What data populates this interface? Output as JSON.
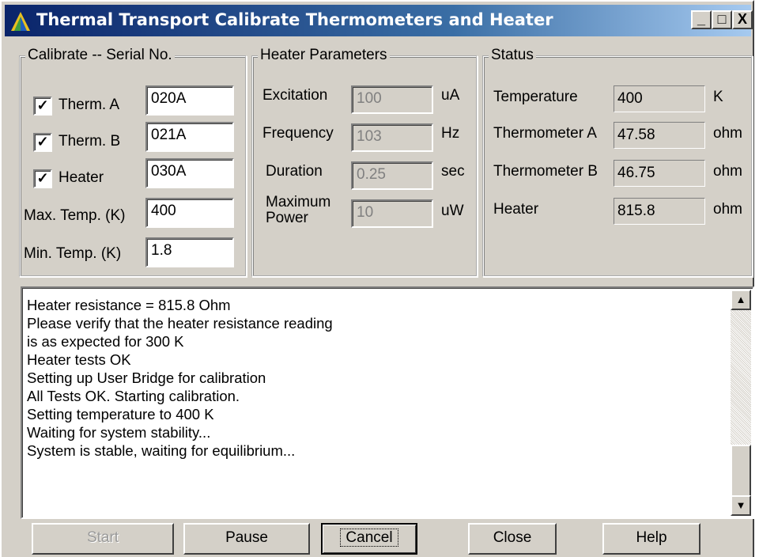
{
  "window": {
    "title": "Thermal Transport Calibrate Thermometers and Heater"
  },
  "caption_buttons": {
    "minimize": "_",
    "maximize": "□",
    "close": "X"
  },
  "calibrate": {
    "group_title": "Calibrate -- Serial No.",
    "items": [
      {
        "label": "Therm. A",
        "checked": true,
        "value": "020A"
      },
      {
        "label": "Therm. B",
        "checked": true,
        "value": "021A"
      },
      {
        "label": "Heater",
        "checked": true,
        "value": "030A"
      }
    ],
    "max_temp": {
      "label": "Max. Temp. (K)",
      "value": "400"
    },
    "min_temp": {
      "label": "Min. Temp. (K)",
      "value": "1.8"
    },
    "check_mark": "✓"
  },
  "heater_params": {
    "group_title": "Heater Parameters",
    "rows": [
      {
        "label": "Excitation",
        "value": "100",
        "unit": "uA"
      },
      {
        "label": "Frequency",
        "value": "103",
        "unit": "Hz"
      },
      {
        "label": "Duration",
        "value": "0.25",
        "unit": "sec"
      },
      {
        "label_line1": "Maximum",
        "label_line2": "Power",
        "value": "10",
        "unit": "uW"
      }
    ]
  },
  "status": {
    "group_title": "Status",
    "rows": [
      {
        "label": "Temperature",
        "value": "400",
        "unit": "K"
      },
      {
        "label": "Thermometer A",
        "value": "47.58",
        "unit": "ohm"
      },
      {
        "label": "Thermometer B",
        "value": "46.75",
        "unit": "ohm"
      },
      {
        "label": "Heater",
        "value": "815.8",
        "unit": "ohm"
      }
    ]
  },
  "log": {
    "lines": [
      "Heater resistance = 815.8 Ohm",
      "Please verify that the heater resistance reading",
      "is as expected for 300 K",
      "Heater tests OK",
      "Setting up User Bridge for calibration",
      "All Tests OK.  Starting calibration.",
      "Setting temperature to 400 K",
      "Waiting for system stability...",
      "System is stable, waiting for equilibrium..."
    ],
    "scroll_up": "▲",
    "scroll_down": "▼"
  },
  "buttons": {
    "start": "Start",
    "pause": "Pause",
    "cancel": "Cancel",
    "close": "Close",
    "help": "Help"
  },
  "colors": {
    "title_gradient_start": "#0a246a",
    "title_gradient_end": "#a6caf0",
    "face": "#d4d0c8"
  }
}
